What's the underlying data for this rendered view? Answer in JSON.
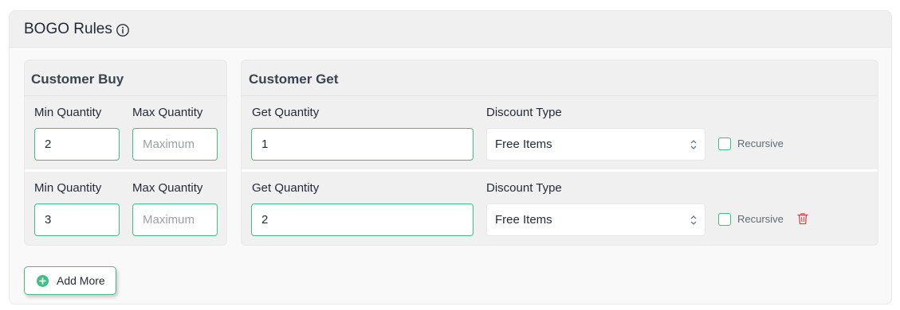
{
  "header": {
    "title": "BOGO Rules",
    "info_icon": "info-circle-icon"
  },
  "customer_buy": {
    "title": "Customer Buy",
    "rows": [
      {
        "min_label": "Min Quantity",
        "min_value": "2",
        "max_label": "Max Quantity",
        "max_placeholder": "Maximum"
      },
      {
        "min_label": "Min Quantity",
        "min_value": "3",
        "max_label": "Max Quantity",
        "max_placeholder": "Maximum"
      }
    ]
  },
  "customer_get": {
    "title": "Customer Get",
    "rows": [
      {
        "qty_label": "Get Quantity",
        "qty_value": "1",
        "discount_label": "Discount Type",
        "discount_value": "Free Items",
        "recursive_label": "Recursive"
      },
      {
        "qty_label": "Get Quantity",
        "qty_value": "2",
        "discount_label": "Discount Type",
        "discount_value": "Free Items",
        "recursive_label": "Recursive",
        "delete_icon": "trash-icon"
      }
    ]
  },
  "actions": {
    "add_more_label": "Add More",
    "add_icon": "plus-circle-icon"
  },
  "colors": {
    "accent": "#3fbf84",
    "danger": "#e0473f"
  }
}
